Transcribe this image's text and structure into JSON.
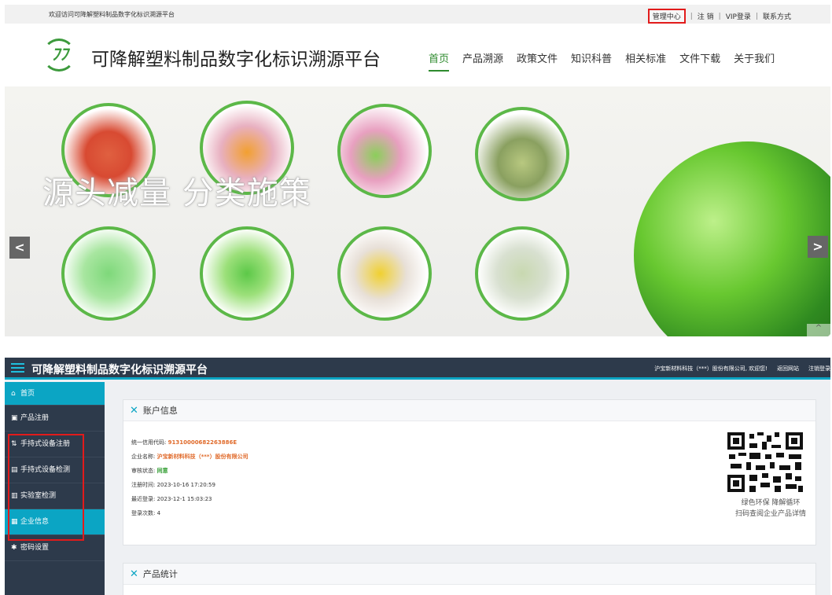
{
  "site": {
    "welcome": "欢迎访问可降解塑料制品数字化标识溯源平台",
    "top_links": [
      "管理中心",
      "注 销",
      "VIP登录",
      "联系方式"
    ],
    "title": "可降解塑料制品数字化标识溯源平台",
    "nav": [
      "首页",
      "产品溯源",
      "政策文件",
      "知识科普",
      "相关标准",
      "文件下载",
      "关于我们"
    ],
    "banner_slogan": "源头减量 分类施策",
    "arrow_left": "<",
    "arrow_right": ">",
    "to_top": "^"
  },
  "admin": {
    "title": "可降解塑料制品数字化标识溯源平台",
    "greeting": "沪宝新材料科技（***）股份有限公司, 欢迎您!",
    "back_link": "返回网站",
    "logout_link": "注销登录",
    "sidebar": [
      {
        "icon": "home-icon",
        "label": "首页"
      },
      {
        "icon": "register-icon",
        "label": "产品注册"
      },
      {
        "icon": "device-register-icon",
        "label": "手持式设备注册"
      },
      {
        "icon": "device-check-icon",
        "label": "手持式设备检测"
      },
      {
        "icon": "lab-icon",
        "label": "实验室检测"
      },
      {
        "icon": "company-icon",
        "label": "企业信息"
      },
      {
        "icon": "gear-icon",
        "label": "密码设置"
      }
    ],
    "account_card": {
      "title": "账户信息",
      "credit_code_label": "统一信用代码:",
      "credit_code": "91310000682263886E",
      "company_label": "企业名称:",
      "company": "沪宝新材料科技（***）股份有限公司",
      "audit_label": "审核状态:",
      "audit": "同意",
      "register_time_label": "注册时间:",
      "register_time": "2023-10-16 17:20:59",
      "last_login_label": "最近登录:",
      "last_login": "2023-12-1 15:03:23",
      "login_count_label": "登录次数:",
      "login_count": "4",
      "qr_caption_1": "绿色环保  降解循环",
      "qr_caption_2": "扫码查阅企业产品详情"
    },
    "product_card": {
      "title": "产品统计"
    }
  },
  "colors": {
    "accent_green": "#2e8b2e",
    "admin_dark": "#2d3a4b",
    "admin_cyan": "#0ba5c4",
    "highlight_red": "#e21b1b"
  }
}
